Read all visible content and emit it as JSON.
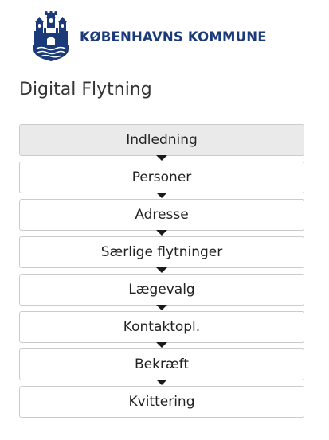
{
  "brand": {
    "name": "KØBENHAVNS KOMMUNE",
    "logo_icon": "copenhagen-coat-of-arms-icon",
    "color": "#1b3a7a"
  },
  "page": {
    "title": "Digital Flytning"
  },
  "steps": [
    {
      "label": "Indledning",
      "active": true
    },
    {
      "label": "Personer",
      "active": false
    },
    {
      "label": "Adresse",
      "active": false
    },
    {
      "label": "Særlige flytninger",
      "active": false
    },
    {
      "label": "Lægevalg",
      "active": false
    },
    {
      "label": "Kontaktopl.",
      "active": false
    },
    {
      "label": "Bekræft",
      "active": false
    },
    {
      "label": "Kvittering",
      "active": false
    }
  ],
  "colors": {
    "active_step_bg": "#eaeaea",
    "arrow": "#1a1a1a"
  }
}
